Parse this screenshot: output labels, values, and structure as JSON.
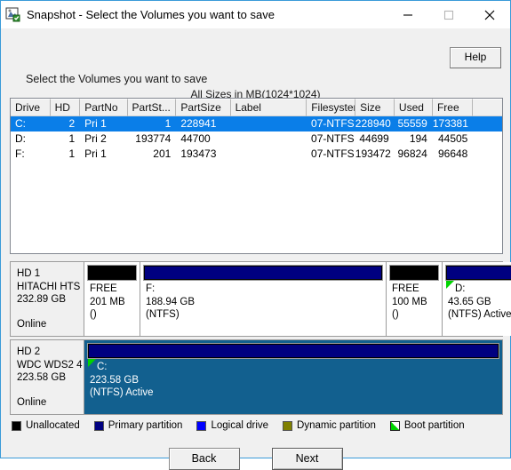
{
  "window": {
    "title": "Snapshot - Select the Volumes you want to save",
    "app_icon": "snapshot-icon",
    "minimize_label": "─",
    "maximize_label": "□",
    "close_label": "✕"
  },
  "toolbar": {
    "help_label": "Help"
  },
  "main": {
    "prompt": "Select the Volumes you want to save",
    "sizes_note": "All Sizes in MB(1024*1024)"
  },
  "table": {
    "columns": [
      {
        "label": "Drive",
        "key": "drive"
      },
      {
        "label": "HD",
        "key": "hd"
      },
      {
        "label": "PartNo",
        "key": "partno"
      },
      {
        "label": "PartSt...",
        "key": "partstart"
      },
      {
        "label": "PartSize",
        "key": "partsize"
      },
      {
        "label": "Label",
        "key": "label"
      },
      {
        "label": "Filesystem",
        "key": "filesystem"
      },
      {
        "label": "Size",
        "key": "size"
      },
      {
        "label": "Used",
        "key": "used"
      },
      {
        "label": "Free",
        "key": "free"
      },
      {
        "label": "",
        "key": "extra"
      }
    ],
    "rows": [
      {
        "drive": "C:",
        "hd": "2",
        "partno": "Pri 1",
        "partstart": "1",
        "partsize": "228941",
        "label": "",
        "filesystem": "07-NTFS",
        "size": "228940",
        "used": "55559",
        "free": "173381",
        "selected": true
      },
      {
        "drive": "D:",
        "hd": "1",
        "partno": "Pri 2",
        "partstart": "193774",
        "partsize": "44700",
        "label": "",
        "filesystem": "07-NTFS",
        "size": "44699",
        "used": "194",
        "free": "44505",
        "selected": false
      },
      {
        "drive": "F:",
        "hd": "1",
        "partno": "Pri 1",
        "partstart": "201",
        "partsize": "193473",
        "label": "",
        "filesystem": "07-NTFS",
        "size": "193472",
        "used": "96824",
        "free": "96648",
        "selected": false
      }
    ]
  },
  "disks": [
    {
      "name": "HD 1",
      "model": "HITACHI  HTS",
      "capacity": "232.89 GB",
      "status": "Online",
      "partitions": [
        {
          "bar": "free",
          "line1": "FREE",
          "line2": "201 MB",
          "line3": "()",
          "boot": false,
          "selected": false
        },
        {
          "bar": "primary",
          "line1": "F:",
          "line2": "188.94 GB",
          "line3": "(NTFS)",
          "boot": false,
          "selected": false
        },
        {
          "bar": "free",
          "line1": "FREE",
          "line2": "100 MB",
          "line3": "()",
          "boot": false,
          "selected": false
        },
        {
          "bar": "primary",
          "line1": "D:",
          "line2": "43.65 GB",
          "line3": "(NTFS) Active",
          "boot": true,
          "selected": false
        }
      ]
    },
    {
      "name": "HD 2",
      "model": "WDC WDS2 4",
      "capacity": "223.58 GB",
      "status": "Online",
      "partitions": [
        {
          "bar": "primary",
          "line1": "C:",
          "line2": "223.58 GB",
          "line3": "(NTFS) Active",
          "boot": true,
          "selected": true
        }
      ]
    }
  ],
  "legend": [
    {
      "label": "Unallocated",
      "color": "#000000"
    },
    {
      "label": "Primary partition",
      "color": "#000080"
    },
    {
      "label": "Logical drive",
      "color": "#0000ff"
    },
    {
      "label": "Dynamic partition",
      "color": "#808000"
    },
    {
      "label": "Boot partition",
      "color": "#00d400"
    }
  ],
  "footer": {
    "back_label": "Back",
    "next_label": "Next"
  },
  "colors": {
    "selection_blue": "#0a7ee8",
    "map_selection": "#12608f",
    "title_accent": "#3a9bd9"
  }
}
